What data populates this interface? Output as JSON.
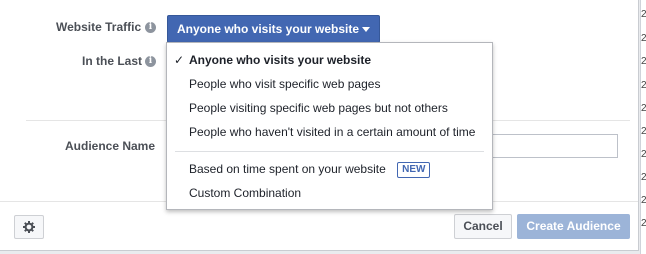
{
  "form": {
    "website_traffic_label": "Website Traffic",
    "in_the_last_label": "In the Last",
    "audience_name_label": "Audience Name",
    "selected_option": "Anyone who visits your website",
    "audience_name_value": ""
  },
  "menu": {
    "items": [
      {
        "label": "Anyone who visits your website",
        "selected": true
      },
      {
        "label": "People who visit specific web pages"
      },
      {
        "label": "People visiting specific web pages but not others"
      },
      {
        "label": "People who haven't visited in a certain amount of time"
      },
      {
        "label": "Based on time spent on your website",
        "badge": "NEW"
      },
      {
        "label": "Custom Combination"
      }
    ],
    "check_mark": "✓"
  },
  "footer": {
    "cancel_label": "Cancel",
    "create_label": "Create Audience"
  },
  "background": {
    "digits": [
      "2",
      "2",
      "2",
      "2",
      "2",
      "2",
      "2",
      "2",
      "2",
      "2"
    ]
  },
  "colors": {
    "accent": "#4267b2",
    "create_disabled": "#9cb4d8"
  }
}
